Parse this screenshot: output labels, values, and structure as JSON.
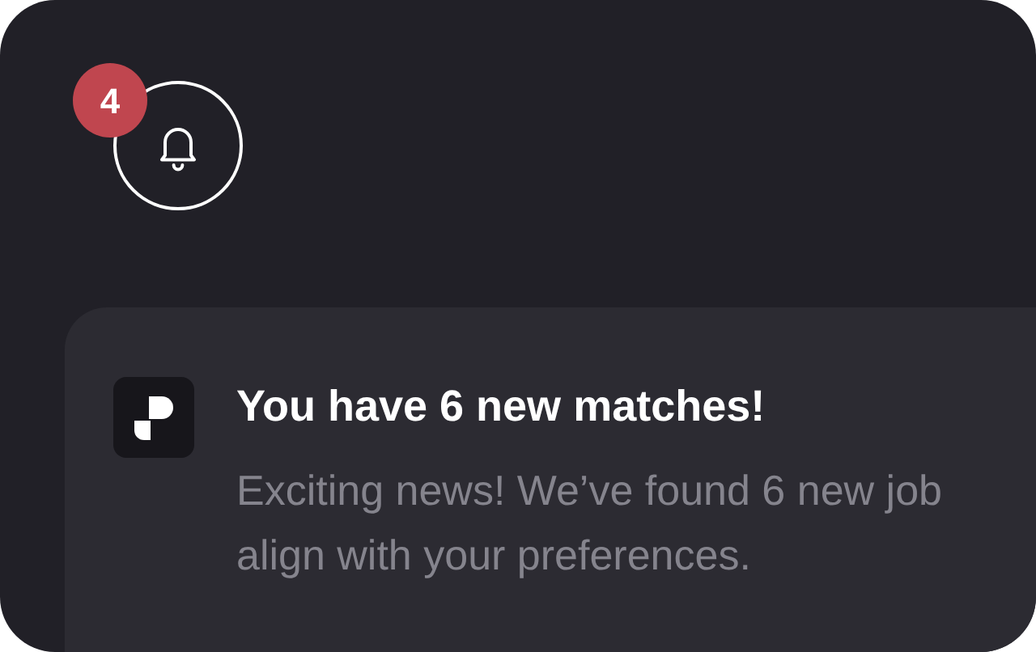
{
  "bell": {
    "badge": "4"
  },
  "notification": {
    "title": "You have 6 new matches!",
    "body_lines": [
      "Exciting news! We’ve found 6 new job",
      "align with your preferences."
    ]
  }
}
